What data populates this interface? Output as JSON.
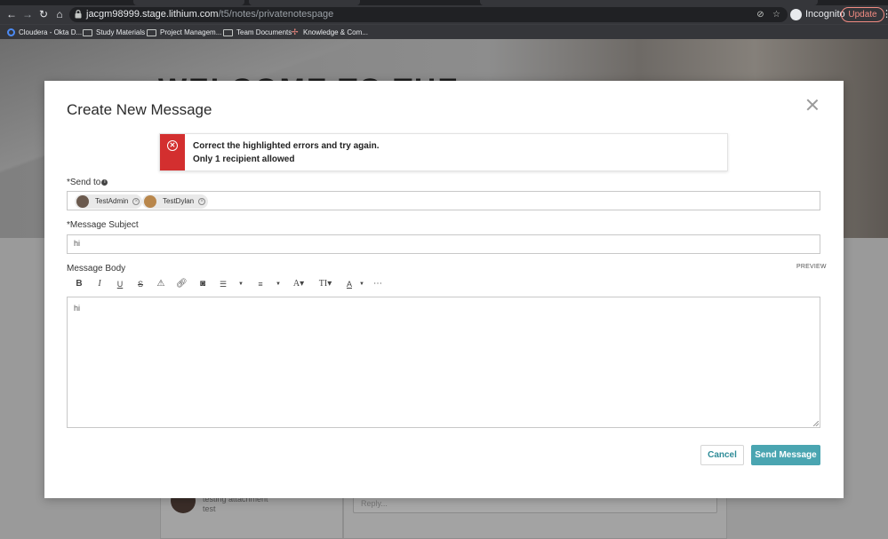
{
  "browser": {
    "url_host": "jacgm98999.stage.lithium.com",
    "url_path": "/t5/notes/privatenotespage",
    "profile_label": "Incognito",
    "update_label": "Update"
  },
  "bookmarks": [
    {
      "label": "Cloudera - Okta D...",
      "icon": "okta-icon"
    },
    {
      "label": "Study Materials",
      "icon": "folder-icon"
    },
    {
      "label": "Project Managem...",
      "icon": "folder-icon"
    },
    {
      "label": "Team Documents",
      "icon": "folder-icon"
    },
    {
      "label": "Knowledge & Com...",
      "icon": "spark-icon"
    }
  ],
  "background": {
    "hero_title": "WELCOME TO THE",
    "msg_preview_title": "testing attachment",
    "msg_preview_body": "test",
    "reply_placeholder": "Reply..."
  },
  "modal": {
    "title": "Create New Message",
    "alert": {
      "line1": "Correct the highlighted errors and try again.",
      "line2": "Only 1 recipient allowed",
      "color": "#d32f2f"
    },
    "send_to": {
      "label": "*Send to",
      "recipients": [
        {
          "name": "TestAdmin"
        },
        {
          "name": "TestDylan"
        }
      ]
    },
    "subject": {
      "label": "*Message Subject",
      "value": "hi"
    },
    "body": {
      "label": "Message Body",
      "preview_label": "PREVIEW",
      "value": "hi"
    },
    "toolbar": [
      "bold-icon",
      "italic-icon",
      "underline-icon",
      "strikethrough-icon",
      "spoiler-icon",
      "link-icon",
      "camera-icon",
      "ordered-list-icon",
      "unordered-list-icon",
      "font-icon",
      "text-size-icon",
      "text-color-icon",
      "more-icon"
    ],
    "buttons": {
      "cancel": "Cancel",
      "send": "Send Message"
    },
    "accent_color": "#4aa5b1"
  }
}
